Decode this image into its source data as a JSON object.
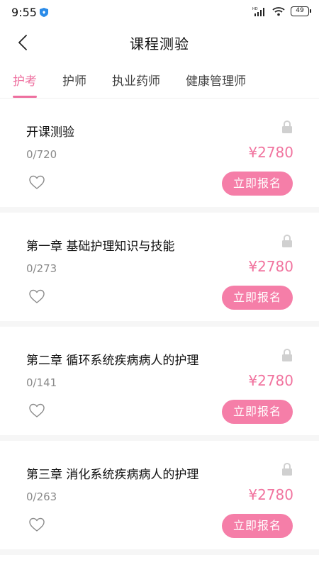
{
  "status_bar": {
    "time": "9:55",
    "battery": "49",
    "icons": [
      "app-shield-icon",
      "hd-signal-icon",
      "wifi-icon",
      "battery-icon"
    ]
  },
  "header": {
    "title": "课程测验",
    "back_icon": "chevron-left-icon"
  },
  "tabs": [
    {
      "label": "护考",
      "active": true
    },
    {
      "label": "护师",
      "active": false
    },
    {
      "label": "执业药师",
      "active": false
    },
    {
      "label": "健康管理师",
      "active": false
    }
  ],
  "courses": [
    {
      "title": "开课测验",
      "progress": "0/720",
      "price": "¥2780",
      "button_label": "立即报名"
    },
    {
      "title": "第一章 基础护理知识与技能",
      "progress": "0/273",
      "price": "¥2780",
      "button_label": "立即报名"
    },
    {
      "title": "第二章 循环系统疾病病人的护理",
      "progress": "0/141",
      "price": "¥2780",
      "button_label": "立即报名"
    },
    {
      "title": "第三章 消化系统疾病病人的护理",
      "progress": "0/263",
      "price": "¥2780",
      "button_label": "立即报名"
    }
  ],
  "colors": {
    "accent": "#ee6f9f",
    "button": "#f57ea8",
    "price": "#f1749f",
    "muted": "#8a8a8a",
    "lock": "#d0d0d0"
  }
}
